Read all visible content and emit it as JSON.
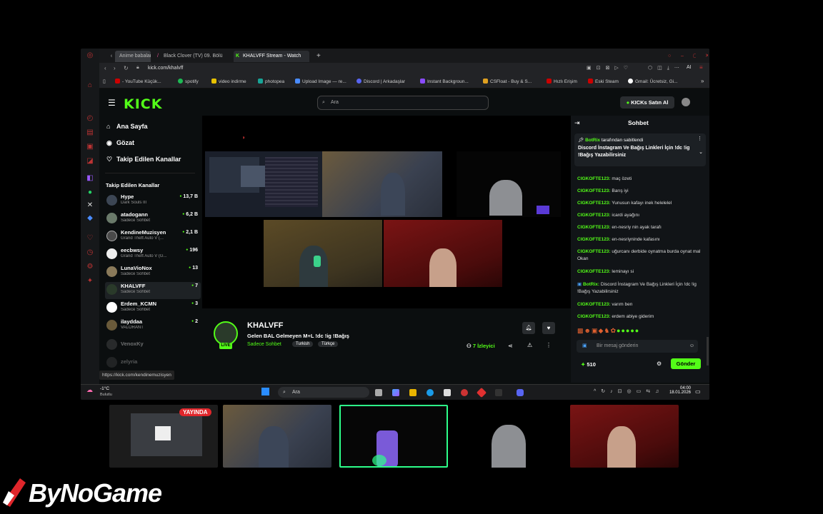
{
  "browser": {
    "tabs": [
      {
        "label": "Anime babalar"
      },
      {
        "label": "Black Clover (TV) 09. Bölü"
      },
      {
        "label": "KHALVFF Stream - Watch"
      }
    ],
    "url": "kick.com/khalvff",
    "bookmarks": [
      "- YouTube Küçük...",
      "spotify",
      "video indirme",
      "photopea",
      "Upload Image — re...",
      "Discord | Arkadaşlar",
      "Instant Backgroun...",
      "CSFloat - Buy & S...",
      "Hızlı Erişim",
      "Eski Steam",
      "Gmail: Ücretsiz, Gi..."
    ],
    "status_url": "https://kick.com/kendinemuzisyen"
  },
  "kick": {
    "logo": "KICK",
    "search_placeholder": "Ara",
    "buy_label": "KICKs Satın Al",
    "nav": [
      {
        "label": "Ana Sayfa",
        "icon": "home-icon"
      },
      {
        "label": "Gözat",
        "icon": "compass-icon"
      },
      {
        "label": "Takip Edilen Kanallar",
        "icon": "heart-icon"
      }
    ],
    "followed_title": "Takip Edilen Kanallar",
    "channels": [
      {
        "name": "Hype",
        "category": "Dark Souls III",
        "viewers": "13,7 B"
      },
      {
        "name": "atadogann",
        "category": "Sadece Sohbet",
        "viewers": "6,2 B"
      },
      {
        "name": "KendineMuzisyen",
        "category": "Grand Theft Auto V (...",
        "viewers": "2,1 B"
      },
      {
        "name": "eecbwsy",
        "category": "Grand Theft Auto V (G...",
        "viewers": "196"
      },
      {
        "name": "LunaVioNox",
        "category": "Sadece Sohbet",
        "viewers": "13"
      },
      {
        "name": "KHALVFF",
        "category": "Sadece Sohbet",
        "viewers": "7"
      },
      {
        "name": "Erdem_KCMN",
        "category": "Sadece Sohbet",
        "viewers": "3"
      },
      {
        "name": "ilayddaa",
        "category": "VALORANT",
        "viewers": "2"
      },
      {
        "name": "VenoxKy",
        "category": "",
        "viewers": ""
      },
      {
        "name": "zelyria",
        "category": "",
        "viewers": ""
      }
    ],
    "stream": {
      "channel": "KHALVFF",
      "title": "Gelen BAL Gelmeyen M+L !dc !ig !Bağış",
      "category": "Sadece Sohbet",
      "tags": [
        "Turkish",
        "Türkçe"
      ],
      "live_badge": "LIVE",
      "viewers": "7 İzleyici"
    },
    "chat": {
      "title": "Sohbet",
      "pinned_by": "BotRix",
      "pinned_suffix": "tarafından sabitlendi",
      "pinned_text": "Discord İnstagram Ve Bağış Linkleri İçin !dc !ig !Bağış Yazabilirsiniz",
      "messages": [
        {
          "user": "CIGKOFTE123:",
          "text": "maç özeti"
        },
        {
          "user": "CIGKOFTE123:",
          "text": "Barış iyi"
        },
        {
          "user": "CIGKOFTE123:",
          "text": "Yunusun kafayı inek helelelel"
        },
        {
          "user": "CIGKOFTE123:",
          "text": "icardi ayağını"
        },
        {
          "user": "CIGKOFTE123:",
          "text": "en-nesriy nin ayak tarafı"
        },
        {
          "user": "CIGKOFTE123:",
          "text": "en-nesriyninde kafasını"
        },
        {
          "user": "CIGKOFTE123:",
          "text": "uğurcanı derbide oynatma burda oynat mal Okan"
        },
        {
          "user": "CIGKOFTE123:",
          "text": "leminayı si"
        },
        {
          "user": "BotRix:",
          "text": "Discord İnstagram Ve Bağış Linkleri İçin !dc !ig !Bağış Yazabilirsiniz"
        },
        {
          "user": "CIGKOFTE123:",
          "text": "varım ben"
        },
        {
          "user": "CIGKOFTE123:",
          "text": "erdem abiye giderim"
        }
      ],
      "input_placeholder": "Bir mesaj gönderin",
      "points": "510",
      "send_label": "Gönder"
    }
  },
  "taskbar": {
    "weather_temp": "-1°C",
    "weather_desc": "Bulutlu",
    "search_placeholder": "Ara",
    "time": "04:00",
    "date": "18.01.2026"
  },
  "overlay": {
    "live_badge": "YAYINDA",
    "brand": "ByNoGame"
  },
  "colors": {
    "accent": "#53fc18",
    "background": "#0b0e0f",
    "live_red": "#e0262b"
  }
}
